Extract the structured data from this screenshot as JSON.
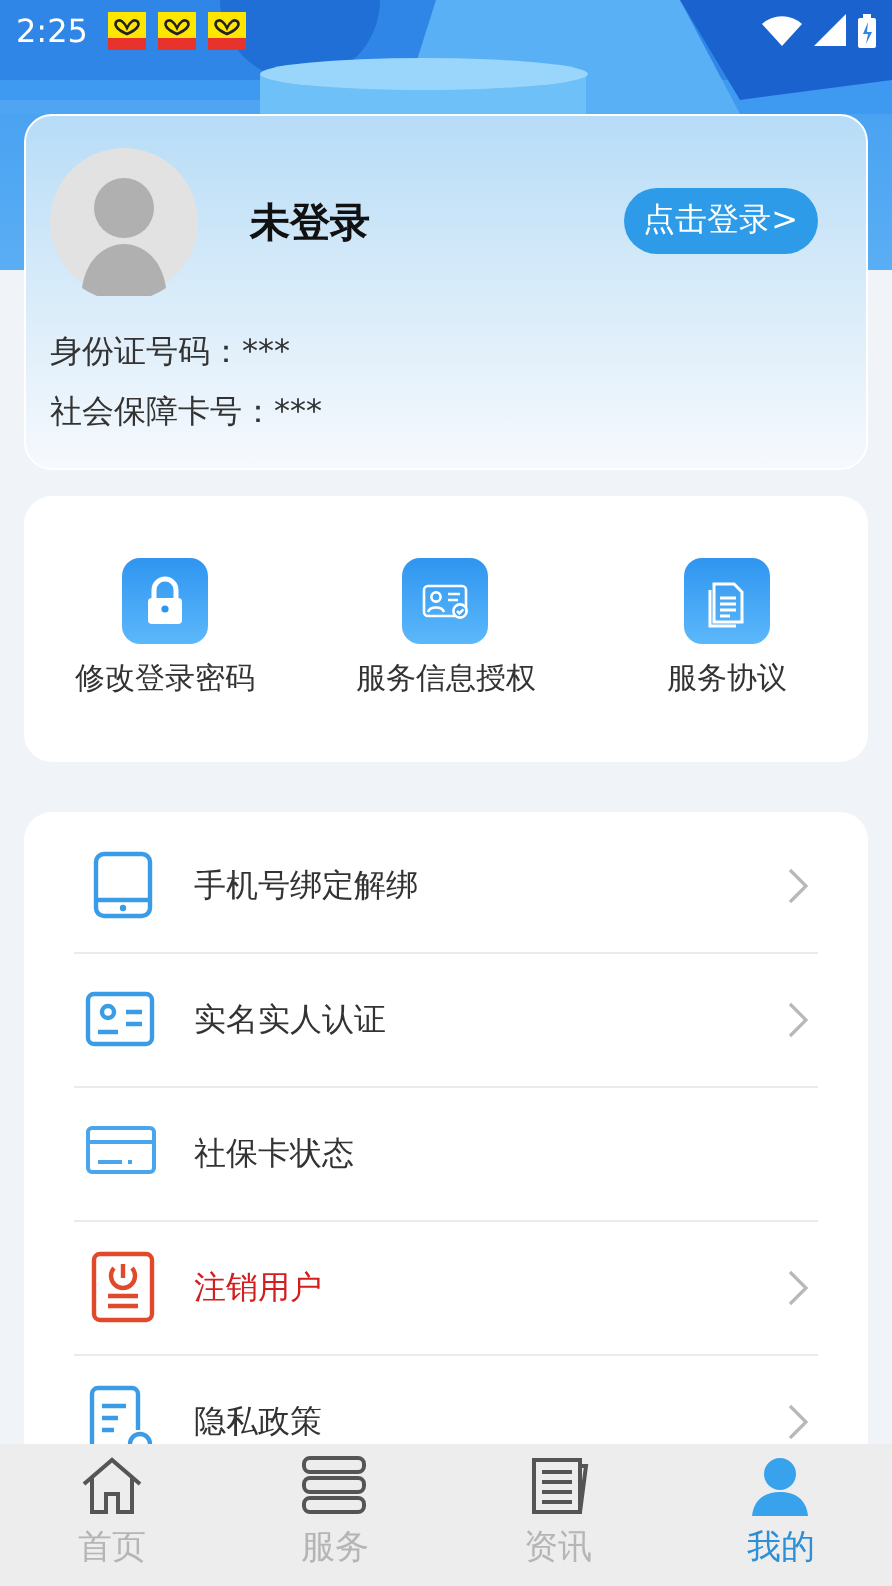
{
  "status_bar": {
    "time": "2:25",
    "notification_icons": [
      {
        "kind": "app"
      },
      {
        "kind": "app"
      },
      {
        "kind": "app"
      }
    ]
  },
  "profile": {
    "name": "未登录",
    "login_button": "点击登录>",
    "fields": [
      {
        "label": "身份证号码：",
        "value": "***"
      },
      {
        "label": "社会保障卡号：",
        "value": "***"
      }
    ]
  },
  "shortcuts": [
    {
      "kind": "lock",
      "label": "修改登录密码"
    },
    {
      "kind": "id-check",
      "label": "服务信息授权"
    },
    {
      "kind": "document",
      "label": "服务协议"
    }
  ],
  "menu": [
    {
      "kind": "phone",
      "label": "手机号绑定解绑",
      "danger": false,
      "chevron": true
    },
    {
      "kind": "id-card",
      "label": "实名实人认证",
      "danger": false,
      "chevron": true
    },
    {
      "kind": "card",
      "label": "社保卡状态",
      "danger": false,
      "chevron": false
    },
    {
      "kind": "power",
      "label": "注销用户",
      "danger": true,
      "chevron": true
    },
    {
      "kind": "policy",
      "label": "隐私政策",
      "danger": false,
      "chevron": true
    }
  ],
  "tabs": [
    {
      "kind": "home",
      "label": "首页",
      "selected": false
    },
    {
      "kind": "services",
      "label": "服务",
      "selected": false
    },
    {
      "kind": "news",
      "label": "资讯",
      "selected": false
    },
    {
      "kind": "me",
      "label": "我的",
      "selected": true
    }
  ]
}
